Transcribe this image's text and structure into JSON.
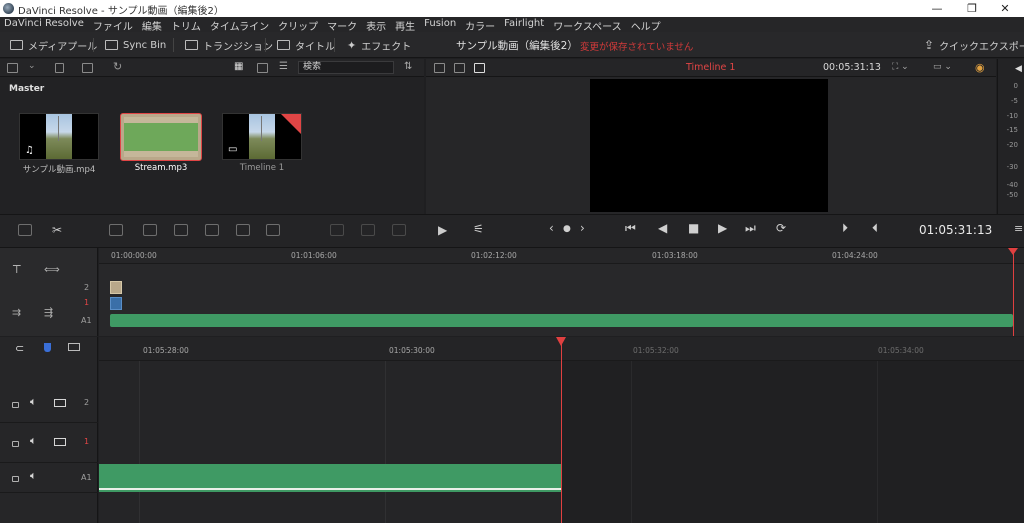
{
  "window": {
    "title": "DaVinci Resolve - サンプル動画（編集後2）",
    "minimize_glyph": "—",
    "maximize_glyph": "❐",
    "close_glyph": "✕"
  },
  "menu": [
    "DaVinci Resolve",
    "ファイル",
    "編集",
    "トリム",
    "タイムライン",
    "クリップ",
    "マーク",
    "表示",
    "再生",
    "Fusion",
    "カラー",
    "Fairlight",
    "ワークスペース",
    "ヘルプ"
  ],
  "toolbar": {
    "media_pool": "メディアプール",
    "sync_bin": "Sync Bin",
    "transitions": "トランジション",
    "titles": "タイトル",
    "effects": "エフェクト",
    "project_title": "サンプル動画（編集後2）",
    "unsaved_notice": "変更が保存されていません",
    "quick_export": "クイックエクスポート"
  },
  "media_pool": {
    "search_placeholder": "検索",
    "bin_label": "Master",
    "clips": [
      {
        "name": "サンプル動画.mp4",
        "badge": "♫"
      },
      {
        "name": "Stream.mp3",
        "badge": ""
      },
      {
        "name": "Timeline 1",
        "badge": "▭"
      }
    ]
  },
  "viewer": {
    "timeline_name": "Timeline 1",
    "timecode": "00:05:31:13",
    "transport_timecode": "01:05:31:13"
  },
  "meters": {
    "labels": [
      "0",
      "-5",
      "-10",
      "-15",
      "-20",
      "-30",
      "-40",
      "-50"
    ]
  },
  "timeline_upper": {
    "ruler": [
      "01:00:00:00",
      "01:01:06:00",
      "01:02:12:00",
      "01:03:18:00",
      "01:04:24:00"
    ],
    "tracks": [
      "2",
      "1",
      "A1"
    ]
  },
  "timeline_lower": {
    "ruler": [
      "01:05:28:00",
      "01:05:30:00",
      "01:05:32:00",
      "01:05:34:00"
    ],
    "tracks": [
      "2",
      "1",
      "A1"
    ]
  },
  "colors": {
    "accent_red": "#e04040",
    "audio_green": "#3f9a64",
    "video_blue": "#3a6fa8",
    "clip_beige": "#b9a88a"
  }
}
